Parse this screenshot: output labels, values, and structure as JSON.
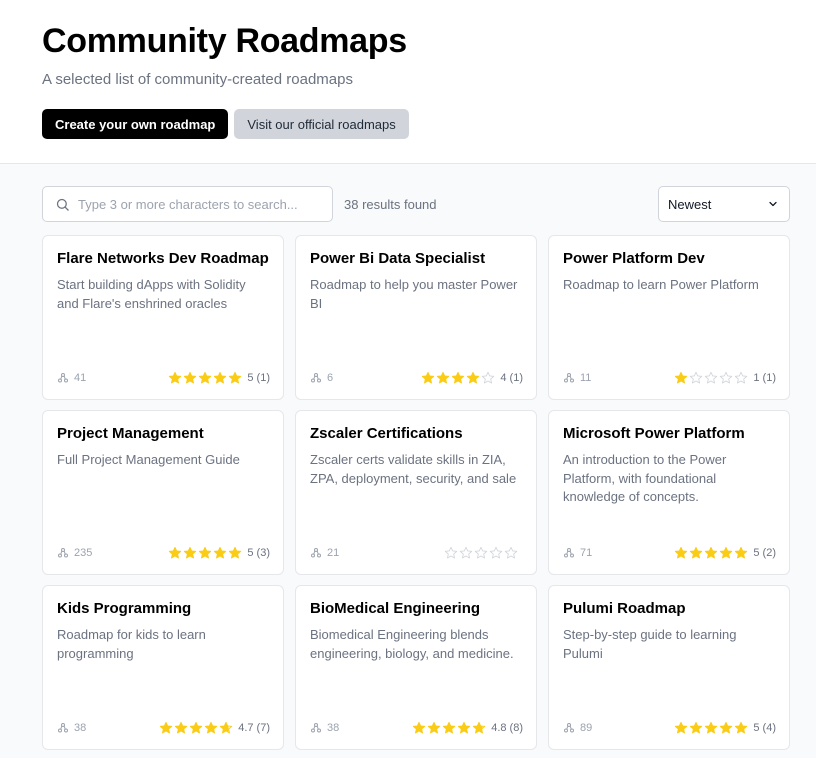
{
  "header": {
    "title": "Community Roadmaps",
    "subtitle": "A selected list of community-created roadmaps",
    "create_button": "Create your own roadmap",
    "official_button": "Visit our official roadmaps"
  },
  "toolbar": {
    "search_placeholder": "Type 3 or more characters to search...",
    "search_value": "",
    "results_text": "38 results found",
    "sort_selected": "Newest"
  },
  "colors": {
    "star_filled": "#facc15",
    "star_empty": "#d1d5db",
    "primary_button": "#000000",
    "secondary_button": "#d1d5db"
  },
  "roadmaps": [
    {
      "title": "Flare Networks Dev Roadmap",
      "description": "Start building dApps with Solidity and Flare's enshrined oracles",
      "users": "41",
      "rating": 5,
      "rating_label": "5 (1)"
    },
    {
      "title": "Power Bi Data Specialist",
      "description": "Roadmap to help you master Power BI",
      "users": "6",
      "rating": 4,
      "rating_label": "4 (1)"
    },
    {
      "title": "Power Platform Dev",
      "description": "Roadmap to learn Power Platform",
      "users": "11",
      "rating": 1,
      "rating_label": "1 (1)"
    },
    {
      "title": "Project Management",
      "description": "Full Project Management Guide",
      "users": "235",
      "rating": 5,
      "rating_label": "5 (3)"
    },
    {
      "title": "Zscaler Certifications",
      "description": "Zscaler certs validate skills in ZIA, ZPA, deployment, security, and sale",
      "users": "21",
      "rating": 0,
      "rating_label": ""
    },
    {
      "title": "Microsoft Power Platform",
      "description": "An introduction to the Power Platform, with foundational knowledge of concepts.",
      "users": "71",
      "rating": 5,
      "rating_label": "5 (2)"
    },
    {
      "title": "Kids Programming",
      "description": "Roadmap for kids to learn programming",
      "users": "38",
      "rating": 4.7,
      "rating_label": "4.7 (7)"
    },
    {
      "title": "BioMedical Engineering",
      "description": "Biomedical Engineering blends engineering, biology, and medicine.",
      "users": "38",
      "rating": 4.8,
      "rating_label": "4.8 (8)"
    },
    {
      "title": "Pulumi Roadmap",
      "description": "Step-by-step guide to learning Pulumi",
      "users": "89",
      "rating": 5,
      "rating_label": "5 (4)"
    }
  ]
}
